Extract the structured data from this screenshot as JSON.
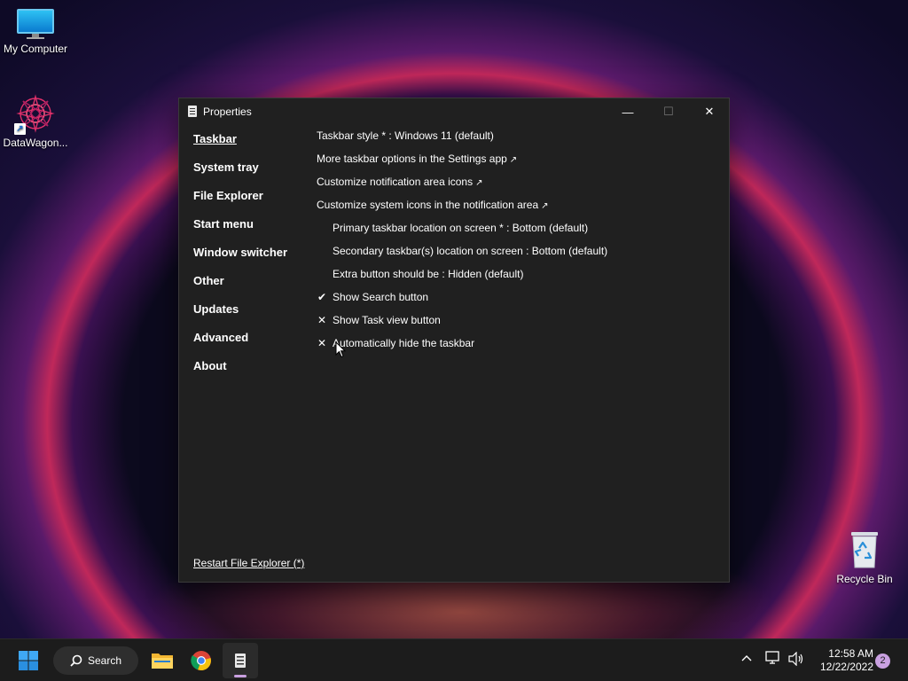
{
  "desktop": {
    "icons": [
      {
        "label": "My Computer"
      },
      {
        "label": "DataWagon..."
      },
      {
        "label": "Recycle Bin"
      }
    ]
  },
  "window": {
    "title": "Properties",
    "controls": {
      "minimize": "—",
      "maximize": "☐",
      "close": "✕"
    },
    "sidebar": {
      "items": [
        {
          "label": "Taskbar",
          "active": true
        },
        {
          "label": "System tray"
        },
        {
          "label": "File Explorer"
        },
        {
          "label": "Start menu"
        },
        {
          "label": "Window switcher"
        },
        {
          "label": "Other"
        },
        {
          "label": "Updates"
        },
        {
          "label": "Advanced"
        },
        {
          "label": "About"
        }
      ]
    },
    "settings": [
      {
        "text": "Taskbar style * : Windows 11 (default)",
        "indent": false,
        "mark": "",
        "external": false
      },
      {
        "text": "More taskbar options in the Settings app",
        "indent": false,
        "mark": "",
        "external": true
      },
      {
        "text": "Customize notification area icons",
        "indent": false,
        "mark": "",
        "external": true
      },
      {
        "text": "Customize system icons in the notification area",
        "indent": false,
        "mark": "",
        "external": true
      },
      {
        "text": "Primary taskbar location on screen * : Bottom (default)",
        "indent": true,
        "mark": "",
        "external": false
      },
      {
        "text": "Secondary taskbar(s) location on screen : Bottom (default)",
        "indent": true,
        "mark": "",
        "external": false
      },
      {
        "text": "Extra button should be : Hidden (default)",
        "indent": true,
        "mark": "",
        "external": false
      },
      {
        "text": "Show Search button",
        "indent": true,
        "mark": "✔",
        "external": false
      },
      {
        "text": "Show Task view button",
        "indent": true,
        "mark": "✕",
        "external": false
      },
      {
        "text": "Automatically hide the taskbar",
        "indent": true,
        "mark": "✕",
        "external": false
      }
    ],
    "external_arrow": "↗",
    "restart_link": "Restart File Explorer (*)"
  },
  "taskbar": {
    "search_label": "Search",
    "clock_time": "12:58 AM",
    "clock_date": "12/22/2022",
    "notification_count": "2"
  },
  "colors": {
    "window_bg": "#202020",
    "taskbar_bg": "#1c1c1c",
    "accent": "#c9a0e0"
  }
}
